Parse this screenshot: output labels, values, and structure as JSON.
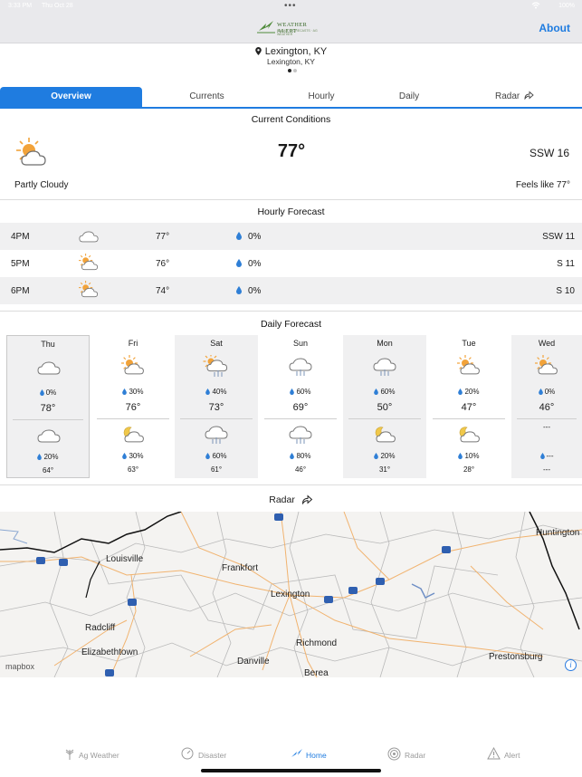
{
  "status_bar": {
    "time": "3:33 PM",
    "date": "Thu Oct 28",
    "battery": "100%",
    "dots": "•••"
  },
  "header": {
    "logo_title": "WEATHER ALERT",
    "logo_subtitle": "RADAR · FORECASTS · AG WEATHER",
    "about_label": "About"
  },
  "location": {
    "city": "Lexington, KY",
    "subtitle": "Lexington, KY"
  },
  "tabs": [
    {
      "label": "Overview"
    },
    {
      "label": "Currents"
    },
    {
      "label": "Hourly"
    },
    {
      "label": "Daily"
    },
    {
      "label": "Radar"
    }
  ],
  "current": {
    "title": "Current Conditions",
    "temp": "77°",
    "wind": "SSW 16",
    "condition": "Partly Cloudy",
    "feels_like": "Feels like 77°",
    "icon": "partly-cloudy-day-icon"
  },
  "hourly": {
    "title": "Hourly Forecast",
    "rows": [
      {
        "time": "4PM",
        "temp": "77°",
        "pop": "0%",
        "wind": "SSW 11",
        "icon": "cloud-icon"
      },
      {
        "time": "5PM",
        "temp": "76°",
        "pop": "0%",
        "wind": "S 11",
        "icon": "partly-cloudy-day-icon"
      },
      {
        "time": "6PM",
        "temp": "74°",
        "pop": "0%",
        "wind": "S 10",
        "icon": "partly-cloudy-day-icon"
      }
    ]
  },
  "daily": {
    "title": "Daily Forecast",
    "days": [
      {
        "name": "Thu",
        "day_icon": "cloud-icon",
        "day_pop": "0%",
        "hi": "78°",
        "night_icon": "cloud-icon",
        "night_pop": "20%",
        "lo": "64°"
      },
      {
        "name": "Fri",
        "day_icon": "partly-cloudy-day-icon",
        "day_pop": "30%",
        "hi": "76°",
        "night_icon": "partly-cloudy-night-icon",
        "night_pop": "30%",
        "lo": "63°"
      },
      {
        "name": "Sat",
        "day_icon": "sun-rain-icon",
        "day_pop": "40%",
        "hi": "73°",
        "night_icon": "rain-cloud-icon",
        "night_pop": "60%",
        "lo": "61°"
      },
      {
        "name": "Sun",
        "day_icon": "rain-cloud-icon",
        "day_pop": "60%",
        "hi": "69°",
        "night_icon": "rain-cloud-icon",
        "night_pop": "80%",
        "lo": "46°"
      },
      {
        "name": "Mon",
        "day_icon": "rain-cloud-icon",
        "day_pop": "60%",
        "hi": "50°",
        "night_icon": "partly-cloudy-night-icon",
        "night_pop": "20%",
        "lo": "31°"
      },
      {
        "name": "Tue",
        "day_icon": "partly-cloudy-day-icon",
        "day_pop": "20%",
        "hi": "47°",
        "night_icon": "partly-cloudy-night-icon",
        "night_pop": "10%",
        "lo": "28°"
      },
      {
        "name": "Wed",
        "day_icon": "partly-cloudy-day-icon",
        "day_pop": "0%",
        "hi": "46°",
        "night_icon": "none",
        "night_pop": "---",
        "lo": "---",
        "night_placeholder": "---"
      }
    ]
  },
  "radar": {
    "title": "Radar",
    "attribution": "mapbox",
    "cities": [
      "Louisville",
      "Frankfort",
      "Lexington",
      "Huntington",
      "Radcliff",
      "Elizabethtown",
      "Richmond",
      "Danville",
      "Berea",
      "Prestonsburg"
    ],
    "highways": [
      "64",
      "64",
      "65",
      "65",
      "64",
      "64",
      "64",
      "64",
      "64",
      "64"
    ]
  },
  "tab_bar": [
    {
      "label": "Ag Weather",
      "icon": "wheat-icon"
    },
    {
      "label": "Disaster",
      "icon": "gauge-icon"
    },
    {
      "label": "Home",
      "icon": "lightning-icon"
    },
    {
      "label": "Radar",
      "icon": "radar-icon"
    },
    {
      "label": "Alert",
      "icon": "warning-icon"
    }
  ],
  "colors": {
    "accent": "#1f7ce0",
    "sun": "#f2a33a",
    "drop": "#2f7fd6",
    "map_bg": "#f4f3f1"
  }
}
